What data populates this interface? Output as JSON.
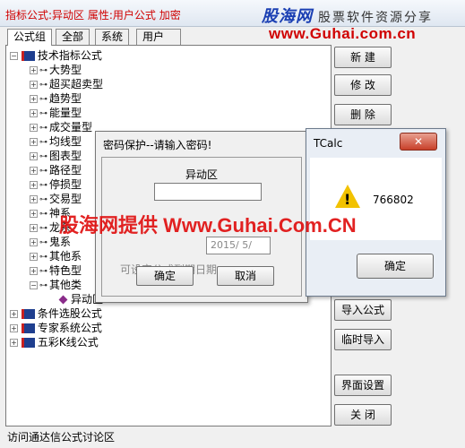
{
  "title": {
    "text": "指标公式:异动区 属性:用户公式 加密"
  },
  "logo": {
    "main": "股海网",
    "slogan": "股票软件资源分享",
    "url": "www.Guhai.com.cn"
  },
  "tabs": [
    "公式组",
    "全部",
    "系统",
    "用户"
  ],
  "tree": {
    "root": "技术指标公式",
    "items": [
      "大势型",
      "超买超卖型",
      "趋势型",
      "能量型",
      "成交量型",
      "均线型",
      "图表型",
      "路径型",
      "停损型",
      "交易型",
      "神系",
      "龙系",
      "鬼系",
      "其他系",
      "特色型",
      "其他类"
    ],
    "leaf": "异动区",
    "others": [
      "条件选股公式",
      "专家系统公式",
      "五彩K线公式"
    ]
  },
  "buttons": {
    "new": "新 建",
    "modify": "修 改",
    "delete": "删 除",
    "import": "导入公式",
    "temp_import": "临时导入",
    "ui_settings": "界面设置",
    "close": "关 闭"
  },
  "status": "访问通达信公式讨论区",
  "password_dialog": {
    "title": "密码保护--请输入密码!",
    "formula_name": "异动区",
    "expire_value": "2015/ 5/",
    "hint": "可设定公式到期日期.",
    "ok": "确定",
    "cancel": "取消"
  },
  "tcalc": {
    "title": "TCalc",
    "close": "✕",
    "warning_mark": "!",
    "message": "766802",
    "ok": "确定"
  },
  "watermark": "股海网提供 Www.Guhai.Com.CN"
}
